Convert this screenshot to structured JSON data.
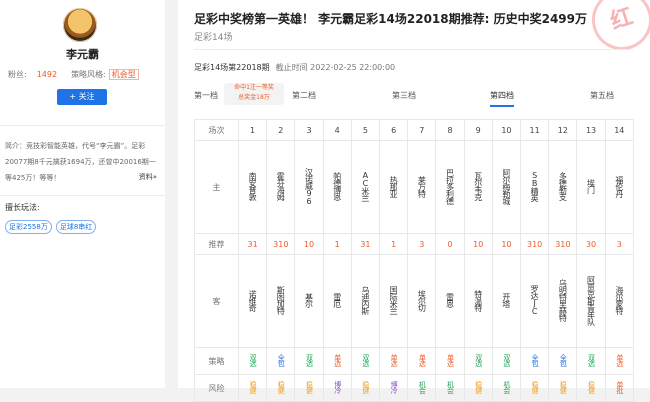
{
  "user": {
    "name": "李元霸",
    "fans_label": "粉丝:",
    "fans": "1492",
    "style_label": "策略风格:",
    "style": "机会型",
    "follow": "+ 关注",
    "intro": "简介：竞技彩智能英雄，代号“李元霸”。足彩20077期8千元擒获1694万，还曾中20016期一等425万！等等！",
    "more": "资料»",
    "tags_title": "擅长玩法:",
    "tags": [
      "足彩2558万",
      "足球8串红"
    ]
  },
  "header": {
    "title": "足彩中奖榜第一英雄！ 李元霸足彩14场22018期推荐: 历史中奖2499万",
    "subtitle": "足彩14场",
    "stamp": "红",
    "meta_period": "足彩14场第22018期",
    "meta_time": "截止时间 2022-02-25 22:00:00"
  },
  "tabs": [
    "第一档",
    "第二档",
    "第三档",
    "第四档",
    "第五档"
  ],
  "active_tab": "第四档",
  "promo": [
    "命中1注一等奖",
    "总奖金18万"
  ],
  "table": {
    "labels": {
      "row": "场次",
      "home": "主",
      "rec": "推荐",
      "away": "客",
      "strategy": "策略",
      "risk": "风险"
    },
    "matches": [
      {
        "num": "1",
        "home": "南安普敦",
        "rec": "31",
        "away": "诺维奇",
        "strategy": "双选",
        "strategy_color": "green",
        "risk": "稳健",
        "risk_color": "orange"
      },
      {
        "num": "2",
        "home": "霍芬海姆",
        "rec": "310",
        "away": "斯图加特",
        "strategy": "全包",
        "strategy_color": "blue",
        "risk": "稳健",
        "risk_color": "orange"
      },
      {
        "num": "3",
        "home": "汉诺威96",
        "rec": "10",
        "away": "基尔",
        "strategy": "双选",
        "strategy_color": "green",
        "risk": "稳健",
        "risk_color": "orange"
      },
      {
        "num": "4",
        "home": "帕德博恩",
        "rec": "1",
        "away": "雷厄",
        "strategy": "单选",
        "strategy_color": "red",
        "risk": "博冷",
        "risk_color": "purple"
      },
      {
        "num": "5",
        "home": "AC米兰",
        "rec": "31",
        "away": "乌迪内斯",
        "strategy": "双选",
        "strategy_color": "green",
        "risk": "稳健",
        "risk_color": "orange"
      },
      {
        "num": "6",
        "home": "热那亚",
        "rec": "1",
        "away": "国际米兰",
        "strategy": "单选",
        "strategy_color": "red",
        "risk": "博冷",
        "risk_color": "purple"
      },
      {
        "num": "7",
        "home": "莱万特",
        "rec": "3",
        "away": "埃尔切",
        "strategy": "单选",
        "strategy_color": "red",
        "risk": "机会",
        "risk_color": "green"
      },
      {
        "num": "8",
        "home": "巴拉多利德",
        "rec": "0",
        "away": "雷恩",
        "strategy": "单选",
        "strategy_color": "red",
        "risk": "机会",
        "risk_color": "green"
      },
      {
        "num": "9",
        "home": "瓦尔韦克",
        "rec": "10",
        "away": "特温特",
        "strategy": "双选",
        "strategy_color": "green",
        "risk": "稳健",
        "risk_color": "orange"
      },
      {
        "num": "10",
        "home": "阿尔梅勒城",
        "rec": "10",
        "away": "开塔",
        "strategy": "双选",
        "strategy_color": "green",
        "risk": "机会",
        "risk_color": "green"
      },
      {
        "num": "11",
        "home": "SB精英",
        "rec": "310",
        "away": "罗达JC",
        "strategy": "全包",
        "strategy_color": "blue",
        "risk": "稳健",
        "risk_color": "orange"
      },
      {
        "num": "12",
        "home": "多德勒支",
        "rec": "310",
        "away": "乌明特里赫特",
        "strategy": "全包",
        "strategy_color": "blue",
        "risk": "稳健",
        "risk_color": "orange"
      },
      {
        "num": "13",
        "home": "埃门",
        "rec": "30",
        "away": "阿贾克斯青年队",
        "strategy": "双选",
        "strategy_color": "green",
        "risk": "稳健",
        "risk_color": "orange"
      },
      {
        "num": "14",
        "home": "福伦丹",
        "rec": "3",
        "away": "海尔蒙特",
        "strategy": "单选",
        "strategy_color": "red",
        "risk": "单批",
        "risk_color": "red"
      }
    ]
  }
}
